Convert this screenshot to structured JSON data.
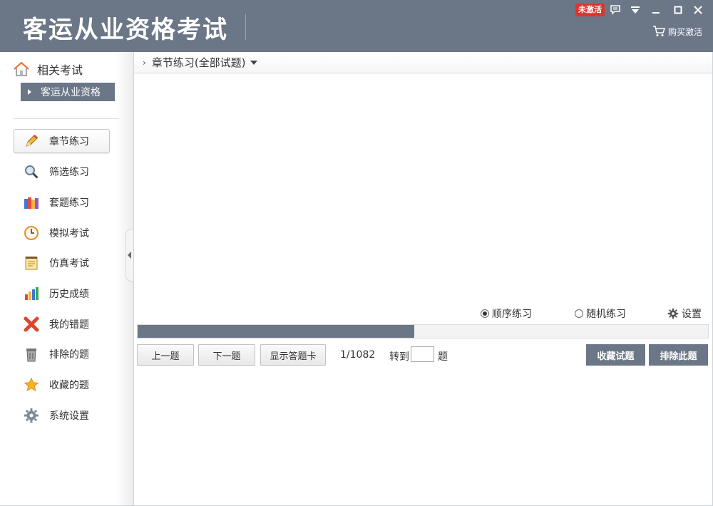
{
  "app": {
    "title": "客运从业资格考试",
    "activation_badge": "未激活",
    "buy_label": "购买激活"
  },
  "colors": {
    "primary": "#6b7787",
    "badge": "#e0332f"
  },
  "sidebar": {
    "related_label": "相关考试",
    "exam_type": "客运从业资格",
    "items": [
      {
        "label": "章节练习",
        "icon": "pencil-icon",
        "active": true
      },
      {
        "label": "筛选练习",
        "icon": "magnifier-icon"
      },
      {
        "label": "套题练习",
        "icon": "books-icon"
      },
      {
        "label": "模拟考试",
        "icon": "clock-icon"
      },
      {
        "label": "仿真考试",
        "icon": "notepad-icon"
      },
      {
        "label": "历史成绩",
        "icon": "bar-chart-icon"
      },
      {
        "label": "我的错题",
        "icon": "red-x-icon"
      },
      {
        "label": "排除的题",
        "icon": "trash-icon"
      },
      {
        "label": "收藏的题",
        "icon": "star-icon"
      },
      {
        "label": "系统设置",
        "icon": "gear-icon"
      }
    ]
  },
  "main": {
    "breadcrumb": "章节练习(全部试题)",
    "mode_sequential": "顺序练习",
    "mode_random": "随机练习",
    "settings_label": "设置",
    "progress_fraction": 0.485,
    "prev_label": "上一题",
    "next_label": "下一题",
    "show_card_label": "显示答题卡",
    "counter": "1/1082",
    "goto_label": "转到",
    "goto_value": "",
    "goto_suffix": "题",
    "favorite_label": "收藏试题",
    "exclude_label": "排除此题"
  }
}
